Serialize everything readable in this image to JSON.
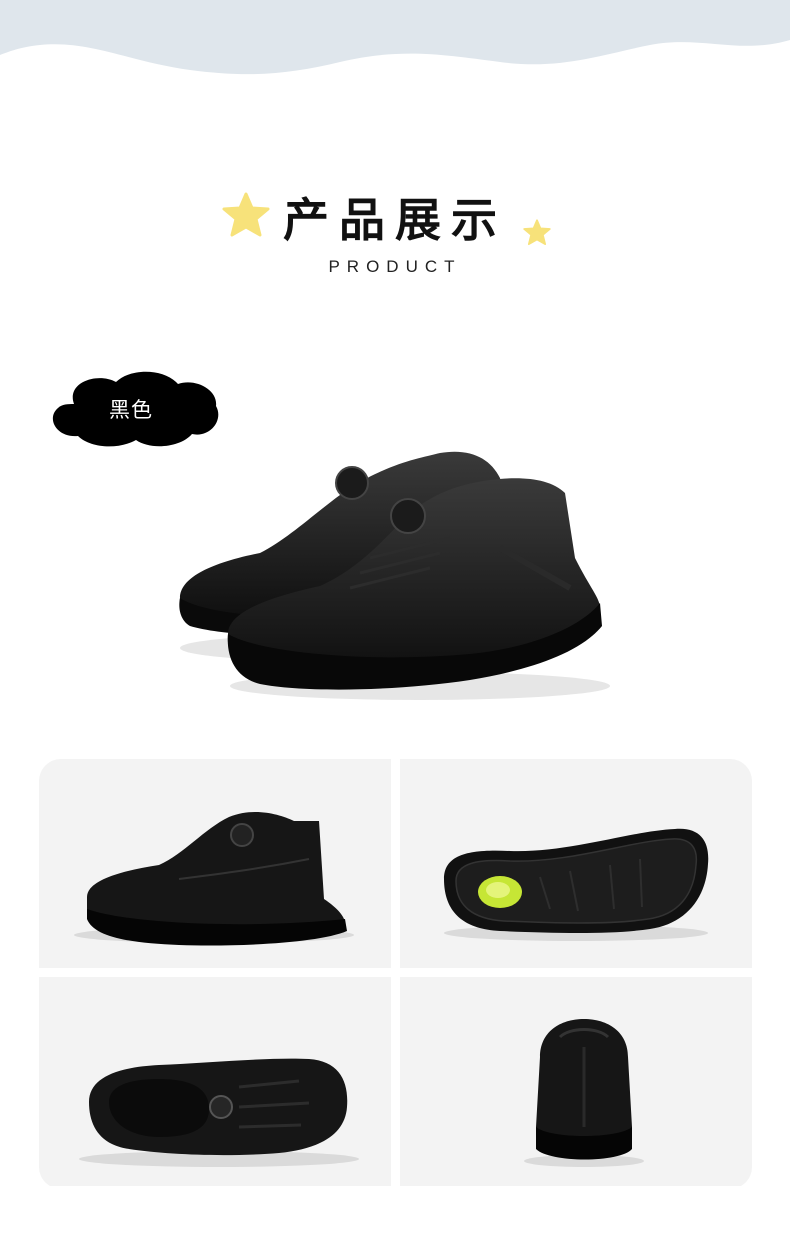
{
  "header": {
    "title_cn": "产品展示",
    "title_en": "PRODUCT"
  },
  "color_tag": {
    "label": "黑色"
  },
  "colors": {
    "wave": "#dfe6ec",
    "star": "#f7e27a",
    "tag_bg": "#000000",
    "shoe": "#151515",
    "insole_accent": "#c6e635",
    "panel_bg": "#f3f3f3"
  },
  "views": [
    {
      "icon": "shoe-side-view"
    },
    {
      "icon": "shoe-sole-view"
    },
    {
      "icon": "shoe-top-view"
    },
    {
      "icon": "shoe-back-view"
    }
  ]
}
